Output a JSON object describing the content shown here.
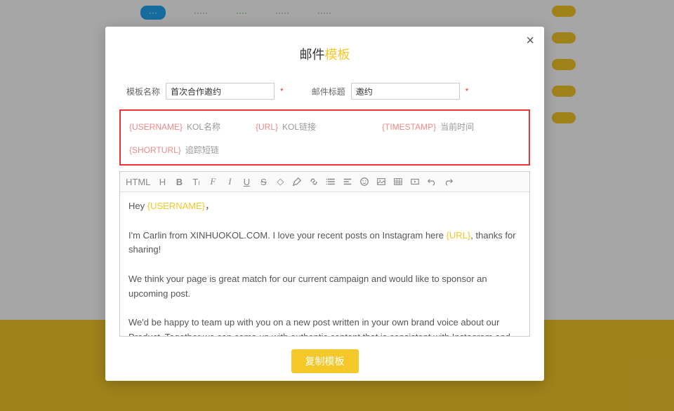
{
  "modal": {
    "title_part1": "邮件",
    "title_part2": "模板",
    "close_icon": "×",
    "form": {
      "name_label": "模板名称",
      "name_value": "首次合作邀约",
      "subject_label": "邮件标题",
      "subject_value": "邀约",
      "required_mark": "*"
    },
    "variables": {
      "row1": [
        {
          "token": "{USERNAME}",
          "desc": "KOL名称"
        },
        {
          "token": "{URL}",
          "desc": "KOL链接"
        },
        {
          "token": "{TIMESTAMP}",
          "desc": "当前时间"
        }
      ],
      "row2": [
        {
          "token": "{SHORTURL}",
          "desc": "追踪短链"
        }
      ]
    },
    "toolbar": {
      "html": "HTML"
    },
    "body": {
      "greeting_prefix": "Hey ",
      "greeting_token": "{USERNAME}",
      "greeting_suffix": "，",
      "p1_prefix": "I'm Carlin from XINHUOKOL.COM. I love your recent posts on Instagram here ",
      "p1_token": "{URL}",
      "p1_suffix": ", thanks for sharing!",
      "p2": "We think your page is great match for our current campaign and would like to sponsor an upcoming post.",
      "p3": "We'd be happy to team up with you on a new post written in your own brand voice about our Product. Together we can come up with authentic content that is consistent with Instagram and appealing to your audience."
    },
    "copy_button": "复制模板"
  }
}
